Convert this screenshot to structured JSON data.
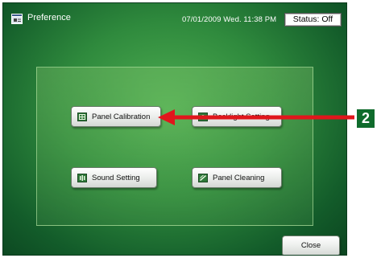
{
  "window": {
    "title": "Preference",
    "datetime": "07/01/2009 Wed. 11:38 PM",
    "status": "Status: Off"
  },
  "buttons": {
    "panel_calibration": "Panel Calibration",
    "backlight_setting": "Backlight Setting",
    "sound_setting": "Sound Setting",
    "panel_cleaning": "Panel Cleaning",
    "close": "Close"
  },
  "callout": {
    "number": "2"
  },
  "colors": {
    "background_green": "#2f8a3d",
    "arrow_red": "#e0161c",
    "callout_green": "#0f6b2c"
  }
}
